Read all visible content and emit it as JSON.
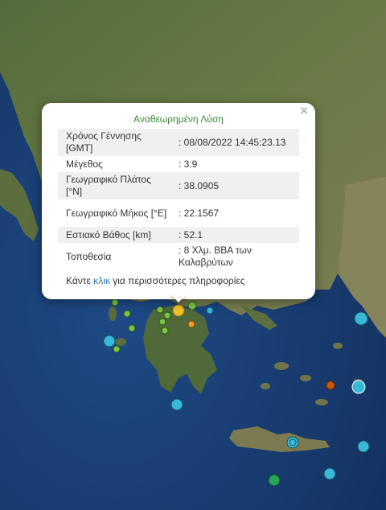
{
  "popup": {
    "title": "Αναθεωρημένη Λύση",
    "close_glyph": "×",
    "rows": [
      {
        "label": "Χρόνος Γέννησης [GMT]",
        "value": ": 08/08/2022 14:45:23.13"
      },
      {
        "label": "Μέγεθος",
        "value": ": 3.9"
      },
      {
        "label": "Γεωγραφικό Πλάτος [°N]",
        "value": ": 38.0905"
      },
      {
        "label": "Γεωγραφικό Μήκος [°E]",
        "value": ": 22.1567"
      },
      {
        "label": "Εστιακό Βάθος [km]",
        "value": ": 52.1"
      },
      {
        "label": "Τοποθεσία",
        "value": ": 8 Χλμ. ΒΒΑ των Καλαβρύτων"
      }
    ],
    "more_prefix": "Κάντε ",
    "more_link": "κλικ",
    "more_suffix": " για περισσότερες πληροφορίες"
  },
  "legend_colors": {
    "recent": "#f2c12e",
    "hours": "#f39c2a",
    "day": "#d35400",
    "days": "#3ab8d8",
    "week": "#7cc443",
    "older": "#27a35a"
  }
}
